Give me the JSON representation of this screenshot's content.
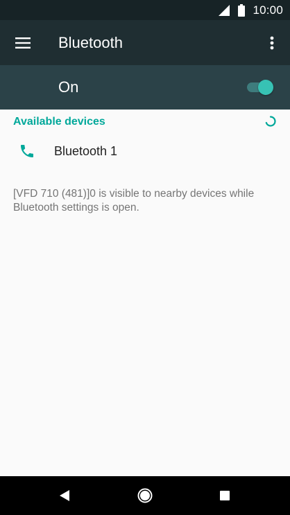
{
  "status_bar": {
    "time": "10:00",
    "icons": [
      "signal-icon",
      "battery-icon"
    ]
  },
  "toolbar": {
    "title": "Bluetooth",
    "menu_icon": "hamburger-menu-icon",
    "overflow_icon": "more-vert-icon"
  },
  "master_switch": {
    "label": "On",
    "checked": true
  },
  "available_devices": {
    "header": "Available devices",
    "scanning": true,
    "devices": [
      {
        "name": "Bluetooth 1",
        "icon": "phone-icon"
      }
    ]
  },
  "visibility_message": "[VFD 710 (481)]0 is visible to nearby devices while Bluetooth settings is open.",
  "colors": {
    "status_bar": "#172326",
    "toolbar": "#1f2e32",
    "master_bar": "#2b4248",
    "accent": "#00a89a",
    "switch_thumb": "#37c2b4"
  },
  "nav_bar": {
    "buttons": [
      "back-icon",
      "home-icon",
      "recents-icon"
    ]
  }
}
